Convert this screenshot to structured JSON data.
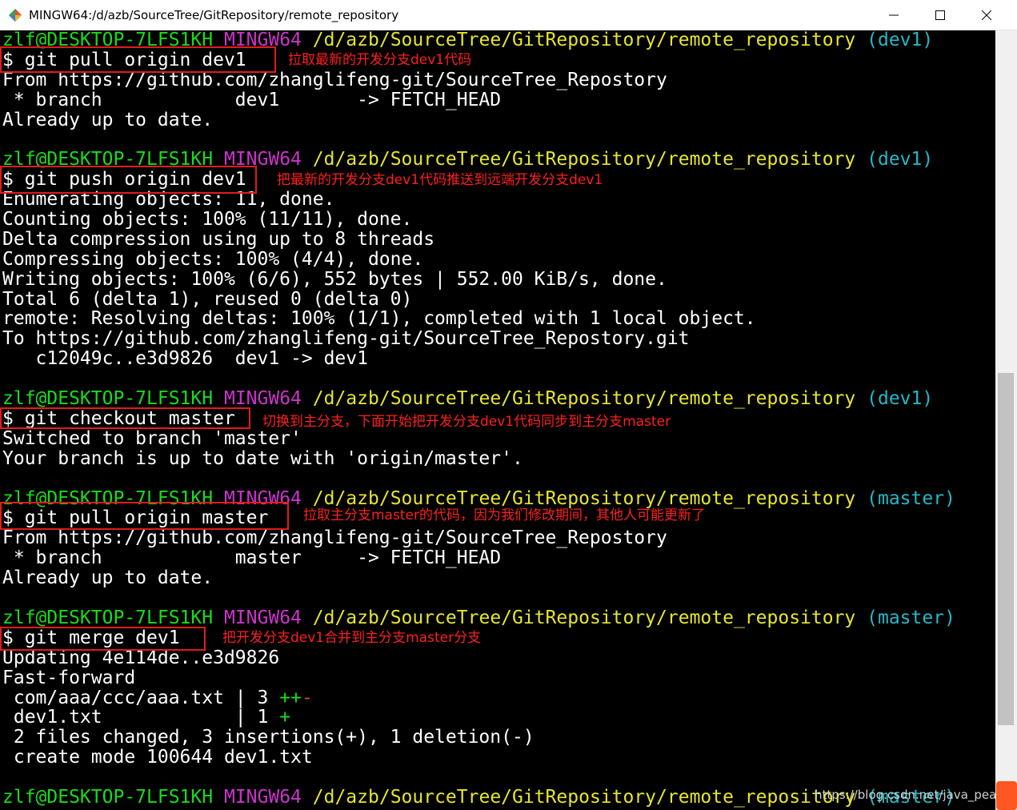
{
  "window": {
    "title": "MINGW64:/d/azb/SourceTree/GitRepository/remote_repository"
  },
  "prompt": {
    "user": "zlf@DESKTOP-7LFS1KH",
    "env": "MINGW64",
    "path": "/d/azb/SourceTree/GitRepository/remote_repository",
    "branch_dev1": "(dev1)",
    "branch_master": "(master)"
  },
  "lines": {
    "cmd1": "$ git pull origin dev1",
    "out1_1": "From https://github.com/zhanglifeng-git/SourceTree_Repostory",
    "out1_2": " * branch            dev1       -> FETCH_HEAD",
    "out1_3": "Already up to date.",
    "cmd2": "$ git push origin dev1",
    "out2_1": "Enumerating objects: 11, done.",
    "out2_2": "Counting objects: 100% (11/11), done.",
    "out2_3": "Delta compression using up to 8 threads",
    "out2_4": "Compressing objects: 100% (4/4), done.",
    "out2_5": "Writing objects: 100% (6/6), 552 bytes | 552.00 KiB/s, done.",
    "out2_6": "Total 6 (delta 1), reused 0 (delta 0)",
    "out2_7": "remote: Resolving deltas: 100% (1/1), completed with 1 local object.",
    "out2_8": "To https://github.com/zhanglifeng-git/SourceTree_Repostory.git",
    "out2_9": "   c12049c..e3d9826  dev1 -> dev1",
    "cmd3": "$ git checkout master",
    "out3_1": "Switched to branch 'master'",
    "out3_2": "Your branch is up to date with 'origin/master'.",
    "cmd4": "$ git pull origin master",
    "out4_1": "From https://github.com/zhanglifeng-git/SourceTree_Repostory",
    "out4_2": " * branch            master     -> FETCH_HEAD",
    "out4_3": "Already up to date.",
    "cmd5": "$ git merge dev1",
    "out5_1": "Updating 4e114de..e3d9826",
    "out5_2": "Fast-forward",
    "out5_3a": " com/aaa/ccc/aaa.txt | 3 ",
    "out5_3b": "++",
    "out5_3c": "-",
    "out5_4a": " dev1.txt            | 1 ",
    "out5_4b": "+",
    "out5_5": " 2 files changed, 3 insertions(+), 1 deletion(-)",
    "out5_6": " create mode 100644 dev1.txt"
  },
  "annotations": {
    "note1": "拉取最新的开发分支dev1代码",
    "note2": "把最新的开发分支dev1代码推送到远端开发分支dev1",
    "note3": "切换到主分支，下面开始把开发分支dev1代码同步到主分支master",
    "note4": "拉取主分支master的代码，因为我们修改期间，其他人可能更新了",
    "note5": "把开发分支dev1合并到主分支master分支"
  },
  "watermark": "https://blog.csdn.net/java_peak_",
  "colors": {
    "prompt_user": "#18dc18",
    "prompt_env": "#cc33cc",
    "prompt_path": "#e6e62b",
    "prompt_branch": "#23b8c8",
    "annotation": "#ff1f1f"
  }
}
